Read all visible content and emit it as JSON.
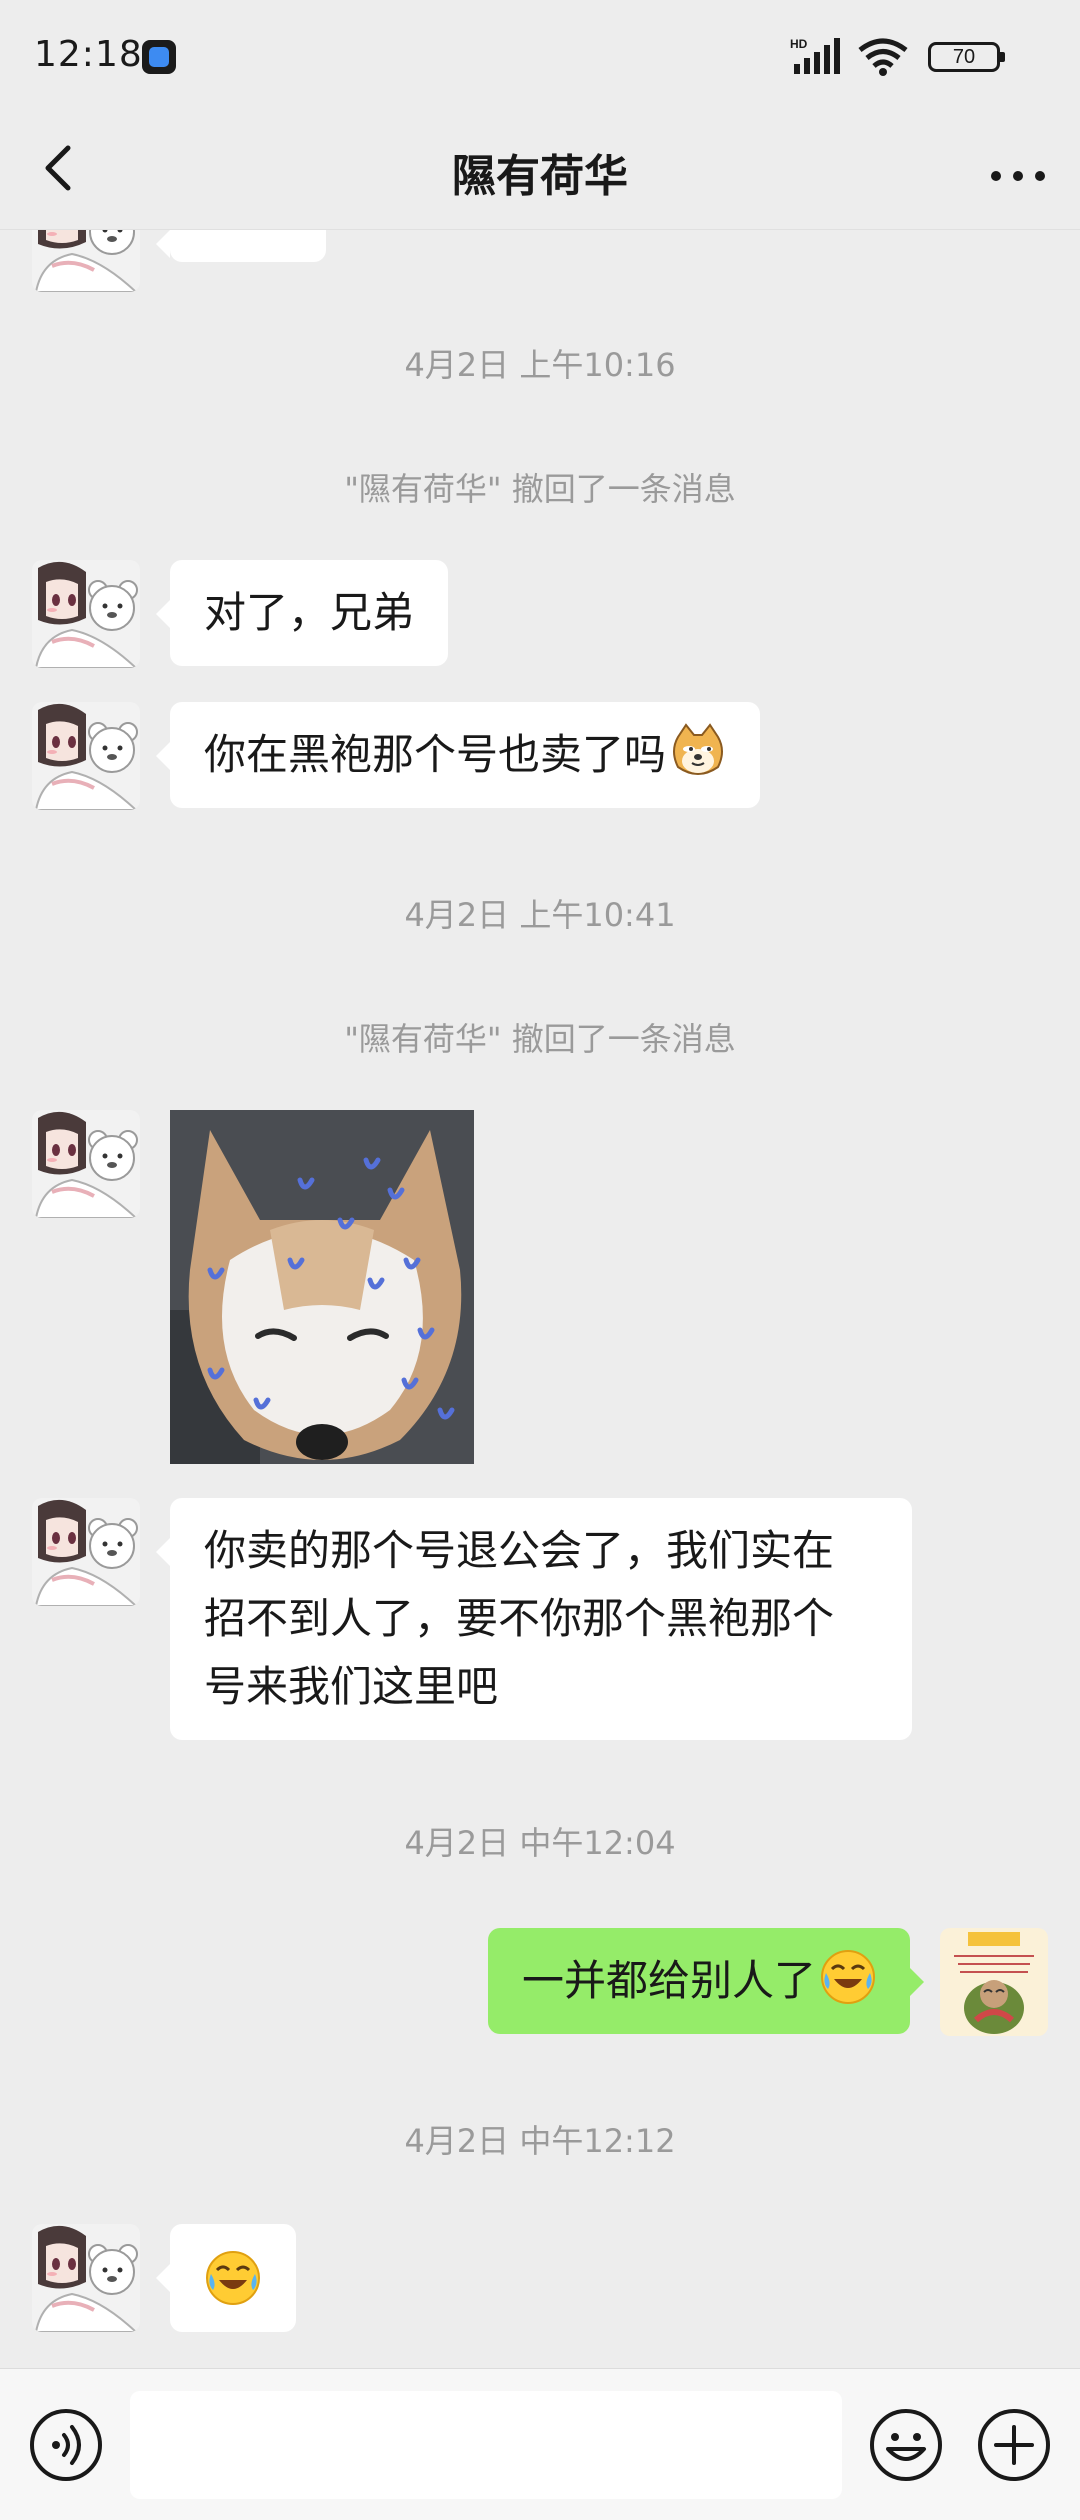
{
  "status_bar": {
    "time": "12:18",
    "battery": "70",
    "network_label": "HD",
    "icons": [
      "app-upload-icon",
      "signal-icon",
      "wifi-icon",
      "battery-icon"
    ]
  },
  "header": {
    "title": "隰有荷华",
    "back_icon": "chevron-left-icon",
    "more_icon": "more-dots-icon"
  },
  "messages": [
    {
      "type": "timestamp",
      "text": "4月2日 上午10:16"
    },
    {
      "type": "system",
      "text": "\"隰有荷华\" 撤回了一条消息"
    },
    {
      "type": "text",
      "side": "left",
      "text": "对了，兄弟"
    },
    {
      "type": "text",
      "side": "left",
      "text": "你在黑袍那个号也卖了吗",
      "emoji": "doge-emoji"
    },
    {
      "type": "timestamp",
      "text": "4月2日 上午10:41"
    },
    {
      "type": "system",
      "text": "\"隰有荷华\" 撤回了一条消息"
    },
    {
      "type": "image",
      "side": "left",
      "content": "shiba-dog-sticker"
    },
    {
      "type": "text",
      "side": "left",
      "lines": [
        "你卖的那个号退公会了，我们实在",
        "招不到人了，要不你那个黑袍那个",
        "号来我们这里吧"
      ]
    },
    {
      "type": "timestamp",
      "text": "4月2日 中午12:04"
    },
    {
      "type": "text",
      "side": "right",
      "text": "一并都给别人了",
      "emoji": "cry-laugh-emoji"
    },
    {
      "type": "timestamp",
      "text": "4月2日 中午12:12"
    },
    {
      "type": "emoji",
      "side": "left",
      "emoji": "cry-laugh-emoji"
    }
  ],
  "input_bar": {
    "placeholder": "",
    "icons": [
      "voice-icon",
      "emoji-icon",
      "plus-icon"
    ]
  },
  "colors": {
    "background": "#ededed",
    "bubble_in": "#ffffff",
    "bubble_out": "#95ec69",
    "meta_text": "#9a9a9a"
  }
}
